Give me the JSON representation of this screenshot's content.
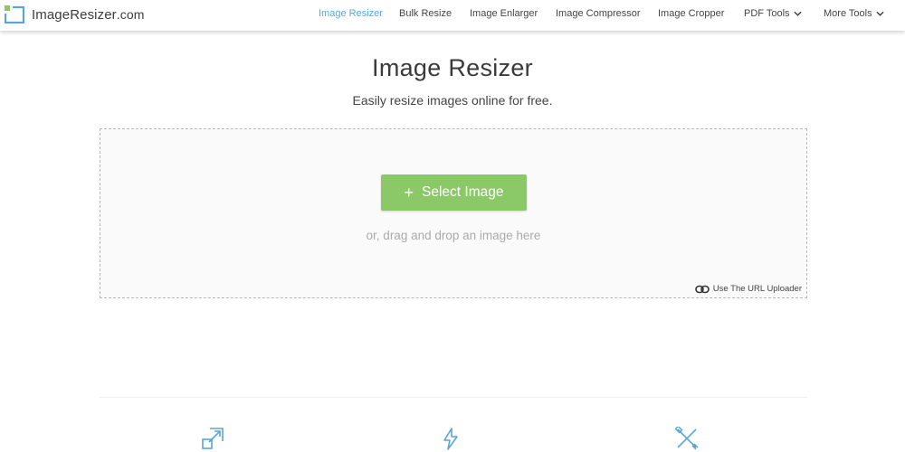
{
  "brand": {
    "name": "ImageResizer",
    "suffix": ".com",
    "accent_color": "#5aa5d8",
    "logo_green": "#8bc867"
  },
  "nav": {
    "items": [
      {
        "label": "Image Resizer",
        "active": true
      },
      {
        "label": "Bulk Resize",
        "active": false
      },
      {
        "label": "Image Enlarger",
        "active": false
      },
      {
        "label": "Image Compressor",
        "active": false
      },
      {
        "label": "Image Cropper",
        "active": false
      },
      {
        "label": "PDF Tools",
        "active": false,
        "dropdown": true
      },
      {
        "label": "More Tools",
        "active": false,
        "dropdown": true
      }
    ]
  },
  "main": {
    "title": "Image Resizer",
    "subtitle": "Easily resize images online for free.",
    "upload": {
      "button_label": "Select Image",
      "button_icon": "plus-icon",
      "button_color": "#8bc867",
      "drag_hint": "or, drag and drop an image here",
      "url_uploader_label": "Use The URL Uploader",
      "url_uploader_icon": "link-icon"
    }
  },
  "features": {
    "icons": [
      "resize-icon",
      "lightning-icon",
      "tools-icon"
    ]
  }
}
